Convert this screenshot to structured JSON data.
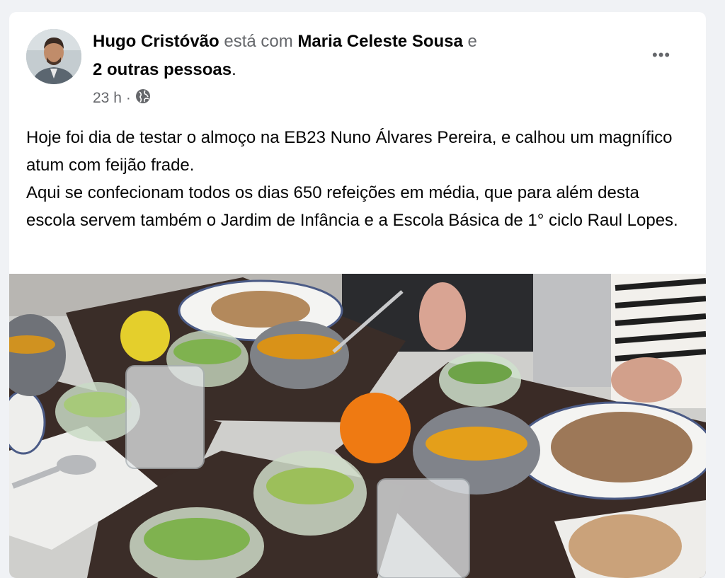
{
  "post": {
    "author": "Hugo Cristóvão",
    "with_text": "está com",
    "tagged": "Maria Celeste Sousa",
    "and_text": "e",
    "others": "2 outras pessoas",
    "period": ".",
    "time": "23 h",
    "separator": "·",
    "audience_icon": "globe-icon",
    "more_label": "•••",
    "paragraphs": [
      "Hoje foi dia de testar o almoço na EB23 Nuno Álvares Pereira, e calhou um magnífico atum com feijão frade.",
      "Aqui se confecionam todos os dias 650 refeições em média, que para além desta escola servem também o Jardim de Infância e a Escola Básica de 1° ciclo Raul Lopes."
    ]
  },
  "colors": {
    "background": "#f0f2f5",
    "card": "#ffffff",
    "text_primary": "#050505",
    "text_secondary": "#65676b"
  }
}
